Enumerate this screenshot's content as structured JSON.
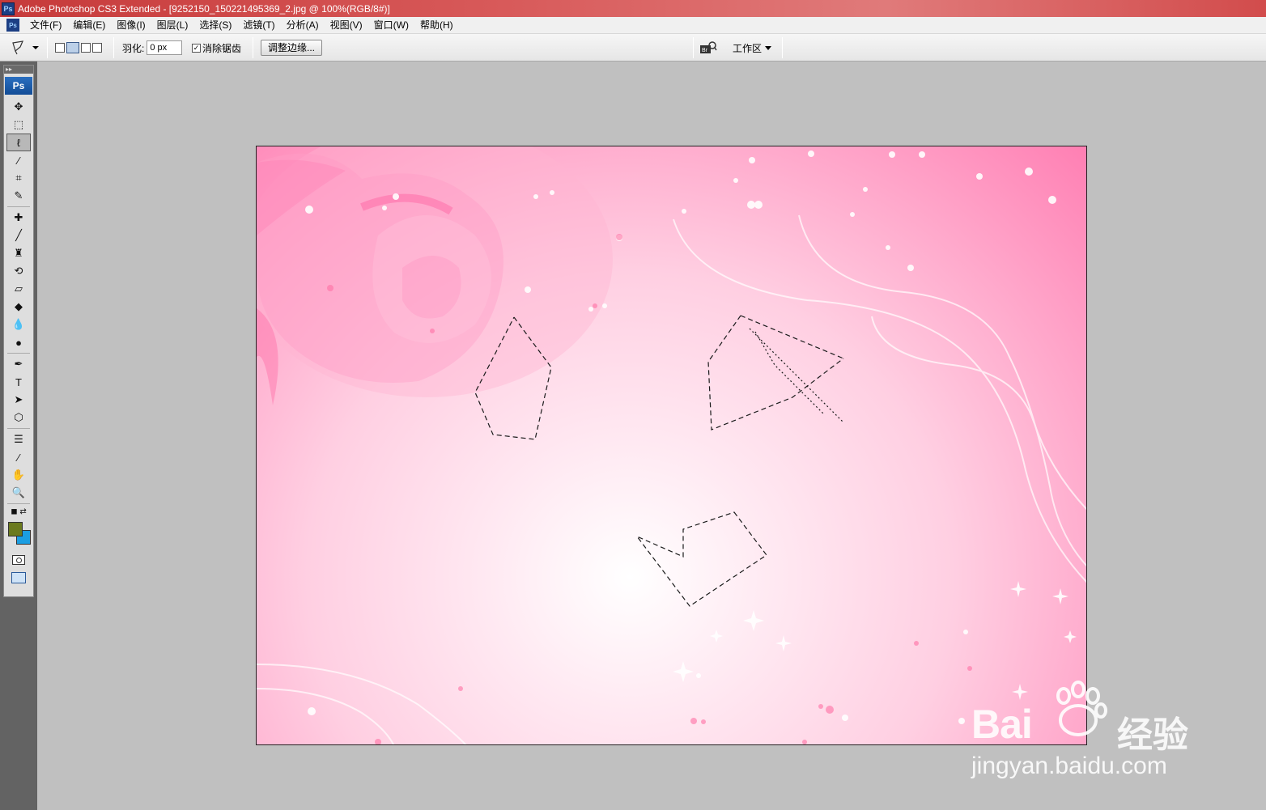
{
  "titlebar": {
    "icon": "Ps",
    "title": "Adobe Photoshop CS3 Extended - [9252150_150221495369_2.jpg @ 100%(RGB/8#)]"
  },
  "menubar": {
    "items": [
      "文件(F)",
      "编辑(E)",
      "图像(I)",
      "图层(L)",
      "选择(S)",
      "滤镜(T)",
      "分析(A)",
      "视图(V)",
      "窗口(W)",
      "帮助(H)"
    ]
  },
  "options": {
    "tool_icon": "polygonal-lasso-icon",
    "feather_label": "羽化:",
    "feather_value": "0 px",
    "antialias_label": "消除锯齿",
    "antialias_checked": true,
    "refine_edge_label": "调整边缘...",
    "workspace_label": "工作区"
  },
  "toolbox": {
    "logo": "Ps",
    "foreground_color": "#6b7a1e",
    "background_color": "#1b9ee2",
    "tools": [
      {
        "name": "move-tool",
        "glyph": "✥"
      },
      {
        "name": "marquee-tool",
        "glyph": "⬚"
      },
      {
        "name": "polygonal-lasso-tool",
        "glyph": "ℓ",
        "active": true
      },
      {
        "name": "magic-wand-tool",
        "glyph": "⁄"
      },
      {
        "name": "crop-tool",
        "glyph": "⌗"
      },
      {
        "name": "slice-tool",
        "glyph": "✎"
      },
      {
        "name": "healing-brush-tool",
        "glyph": "✚"
      },
      {
        "name": "brush-tool",
        "glyph": "╱"
      },
      {
        "name": "clone-stamp-tool",
        "glyph": "♜"
      },
      {
        "name": "history-brush-tool",
        "glyph": "⟲"
      },
      {
        "name": "eraser-tool",
        "glyph": "▱"
      },
      {
        "name": "paint-bucket-tool",
        "glyph": "◆"
      },
      {
        "name": "blur-tool",
        "glyph": "💧"
      },
      {
        "name": "dodge-tool",
        "glyph": "●"
      },
      {
        "name": "pen-tool",
        "glyph": "✒"
      },
      {
        "name": "type-tool",
        "glyph": "T"
      },
      {
        "name": "path-selection-tool",
        "glyph": "➤"
      },
      {
        "name": "shape-tool",
        "glyph": "⬡"
      },
      {
        "name": "notes-tool",
        "glyph": "☰"
      },
      {
        "name": "eyedropper-tool",
        "glyph": "⁄"
      },
      {
        "name": "hand-tool",
        "glyph": "✋"
      },
      {
        "name": "zoom-tool",
        "glyph": "🔍"
      }
    ]
  },
  "document": {
    "filename": "9252150_150221495369_2.jpg",
    "zoom": "100%",
    "mode": "RGB/8#"
  },
  "watermark": {
    "brand": "Bai",
    "brand_suffix": "du",
    "cn": "经验",
    "url": "jingyan.baidu.com"
  }
}
